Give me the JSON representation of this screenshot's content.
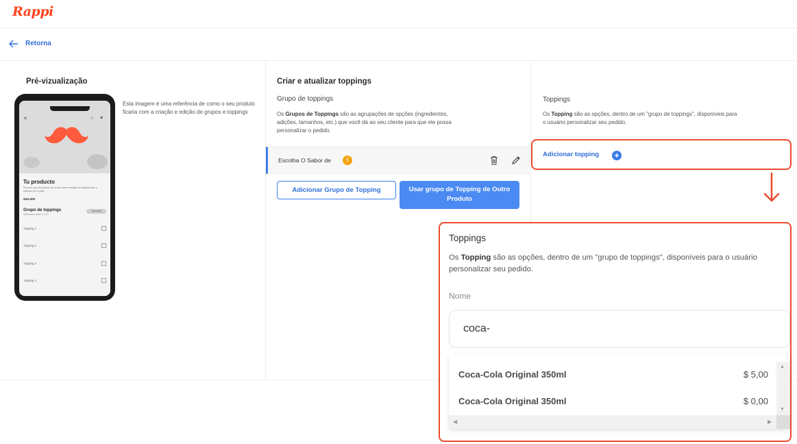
{
  "brand": {
    "logo_text": "Rappi",
    "color": "#ff441f",
    "accent": "#3b7de9",
    "highlight": "#ec4a2c"
  },
  "nav": {
    "back_label": "Retorna"
  },
  "preview": {
    "title": "Pré-vizualização",
    "description": "Esta imagem é uma referência de como o seu produto ficaria com a criação e edição de grupos e toppings",
    "phone": {
      "product_title": "Tu producto",
      "product_desc": "Estoces una descripción de donde debes resaltar los ingredientes y sabores de tu plato",
      "price": "$40.000",
      "group_title": "Grupo de toppings",
      "group_sub": "Selecciona entre 3 y 10",
      "badge": "Opcional",
      "items": [
        "Topping 1",
        "Topping 2",
        "Topping 3",
        "Topping 4"
      ]
    }
  },
  "create": {
    "title": "Criar e atualizar toppings",
    "subtitle": "Grupo de toppings",
    "desc_bold": "Grupos de Toppings",
    "desc_pre": "Os ",
    "desc_post": " são as agrupações de opções (ingredientes, adições, tamanhos, etc.) que você dá ao seu cliente para que ele possa personalizar o pedido.",
    "group_name": "Escolha O Sabor de",
    "warning_icon": "exclamation-icon",
    "add_group_button": "Adicionar Grupo de Topping",
    "use_group_button": "Usar grupo de Topping de Outro Produto"
  },
  "toppings": {
    "title": "Toppings",
    "desc_pre": "Os ",
    "desc_bold": "Topping",
    "desc_post": " são as opções, dentro de um \"grupo de toppings\", disponíveis para o usuário personalizar seu pedido.",
    "add_button": "Adicionar topping"
  },
  "zoom": {
    "title": "Toppings",
    "desc_pre": "Os ",
    "desc_bold": "Topping",
    "desc_post": " são as opções, dentro de um \"grupo de toppings\", disponíveis para o usuário personalizar seu pedido.",
    "field_label": "Nome",
    "field_value": "coca-",
    "options": [
      {
        "name": "Coca-Cola Original 350ml",
        "price": "$ 5,00"
      },
      {
        "name": "Coca-Cola Original 350ml",
        "price": "$ 0,00"
      }
    ]
  }
}
